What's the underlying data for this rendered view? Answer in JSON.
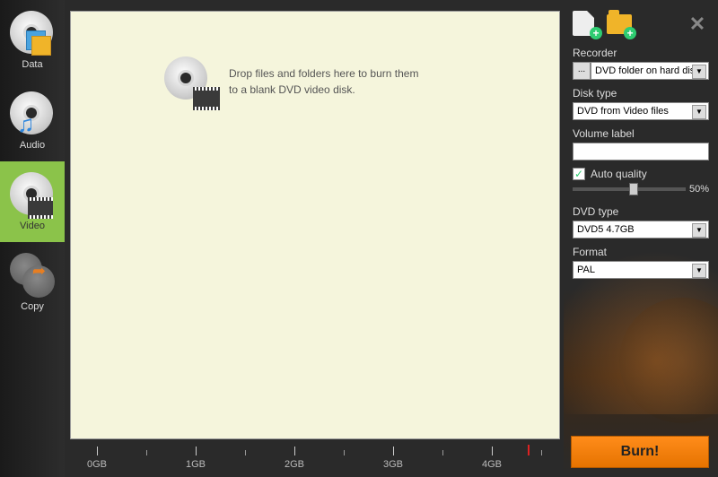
{
  "sidebar": {
    "items": [
      {
        "label": "Data"
      },
      {
        "label": "Audio"
      },
      {
        "label": "Video"
      },
      {
        "label": "Copy"
      }
    ],
    "active_index": 2
  },
  "main": {
    "drop_text_line1": "Drop files and folders here to burn them",
    "drop_text_line2": "to a blank DVD video disk."
  },
  "ruler": {
    "labels": [
      "0GB",
      "1GB",
      "2GB",
      "3GB",
      "4GB"
    ]
  },
  "panel": {
    "recorder": {
      "label": "Recorder",
      "value": "DVD folder on hard disk",
      "browse": "..."
    },
    "disk_type": {
      "label": "Disk type",
      "value": "DVD from Video files"
    },
    "volume_label": {
      "label": "Volume label",
      "value": ""
    },
    "auto_quality": {
      "label": "Auto quality",
      "checked": true
    },
    "quality_slider": {
      "percent": 50,
      "display": "50%"
    },
    "dvd_type": {
      "label": "DVD type",
      "value": "DVD5 4.7GB"
    },
    "format": {
      "label": "Format",
      "value": "PAL"
    },
    "burn_label": "Burn!"
  }
}
